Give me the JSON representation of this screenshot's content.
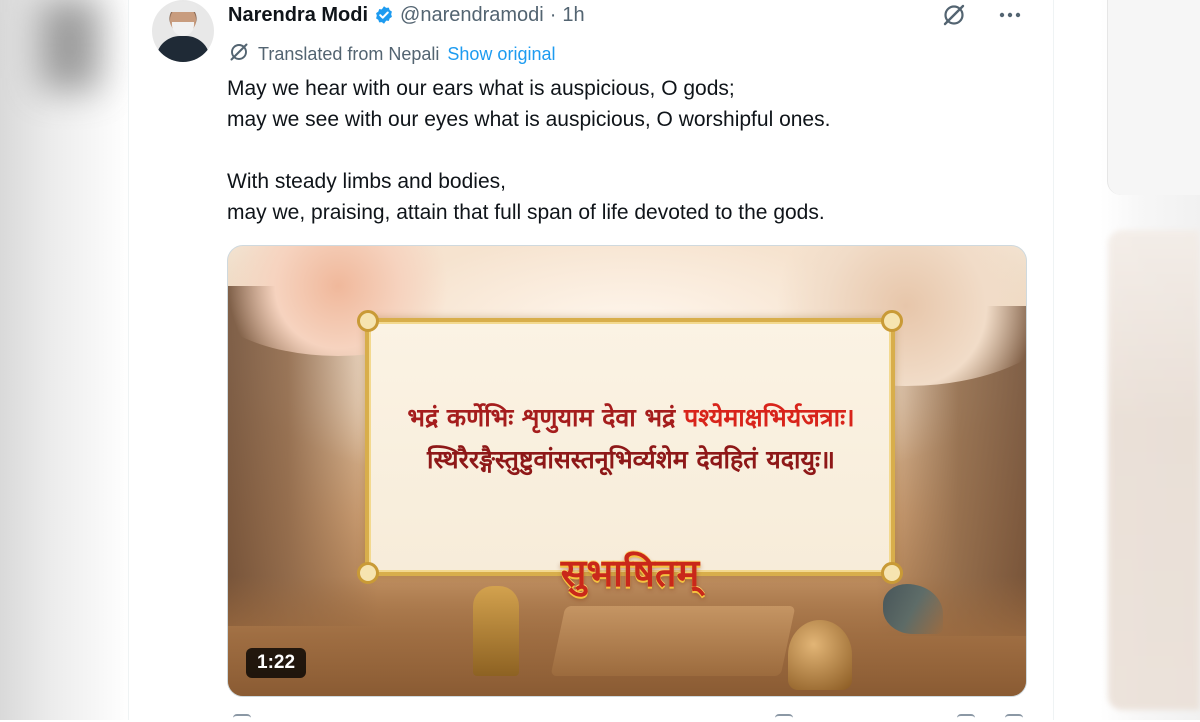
{
  "tweet": {
    "author_name": "Narendra Modi",
    "handle": "@narendramodi",
    "separator": "·",
    "time": "1h",
    "translation_note": "Translated from Nepali",
    "show_original": "Show original",
    "body_lines": [
      "May we hear with our ears what is auspicious, O gods;",
      "may we see with our eyes what is auspicious, O worshipful ones.",
      "With steady limbs and bodies,",
      "may we, praising, attain that full span of life devoted to the gods."
    ]
  },
  "media": {
    "sanskrit_line1_part1": "भद्रं कर्णेभिः शृणुयाम देवा भद्रं ",
    "sanskrit_line1_part2": "पश्येमाक्षभिर्यजत्राः।",
    "sanskrit_line2": "स्थिरैरङ्गैस्तुष्टुवांसस्तनूभिर्व्यशेम देवहितं यदायुः॥",
    "title": "सुभाषितम्",
    "duration": "1:22"
  },
  "icons": {
    "verified": "verified-badge-icon",
    "grok": "grok-icon",
    "more": "more-icon",
    "translate": "translate-icon"
  },
  "colors": {
    "link": "#1d9bf0",
    "secondary_text": "#536471",
    "primary_text": "#0f1419"
  }
}
